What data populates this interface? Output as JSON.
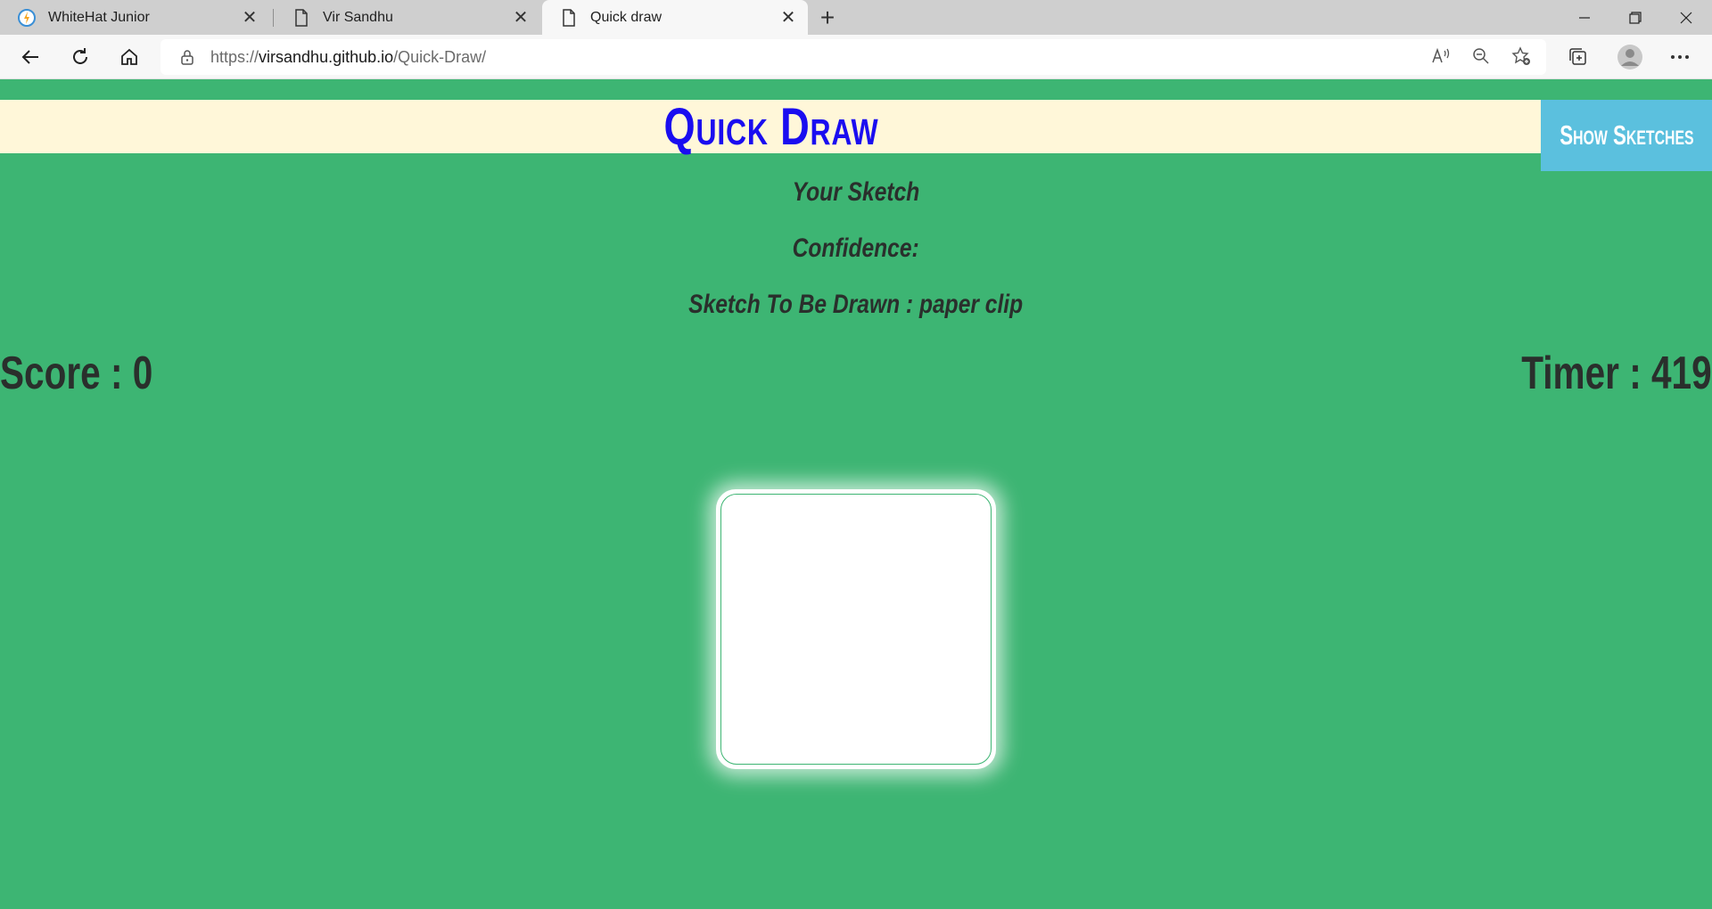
{
  "browser": {
    "tabs": [
      {
        "title": "WhiteHat Junior",
        "icon": "whitehat-favicon-icon",
        "active": false
      },
      {
        "title": "Vir Sandhu",
        "icon": "page-icon",
        "active": false
      },
      {
        "title": "Quick draw",
        "icon": "page-icon",
        "active": true
      }
    ],
    "url_prefix": "https://",
    "url_host": "virsandhu.github.io",
    "url_path": "/Quick-Draw/"
  },
  "page": {
    "title": "Quick Draw",
    "show_sketches_label": "Show Sketches",
    "your_sketch_label": "Your Sketch",
    "confidence_label": "Confidence:",
    "sketch_to_draw_label": "Sketch To Be Drawn : paper clip",
    "score_label": "Score : 0",
    "timer_label": "Timer : 419"
  },
  "colors": {
    "background": "#3db573",
    "header_band": "#fff7d9",
    "title": "#1a0df0",
    "button": "#5bc0de",
    "text": "#2a2f2c"
  }
}
